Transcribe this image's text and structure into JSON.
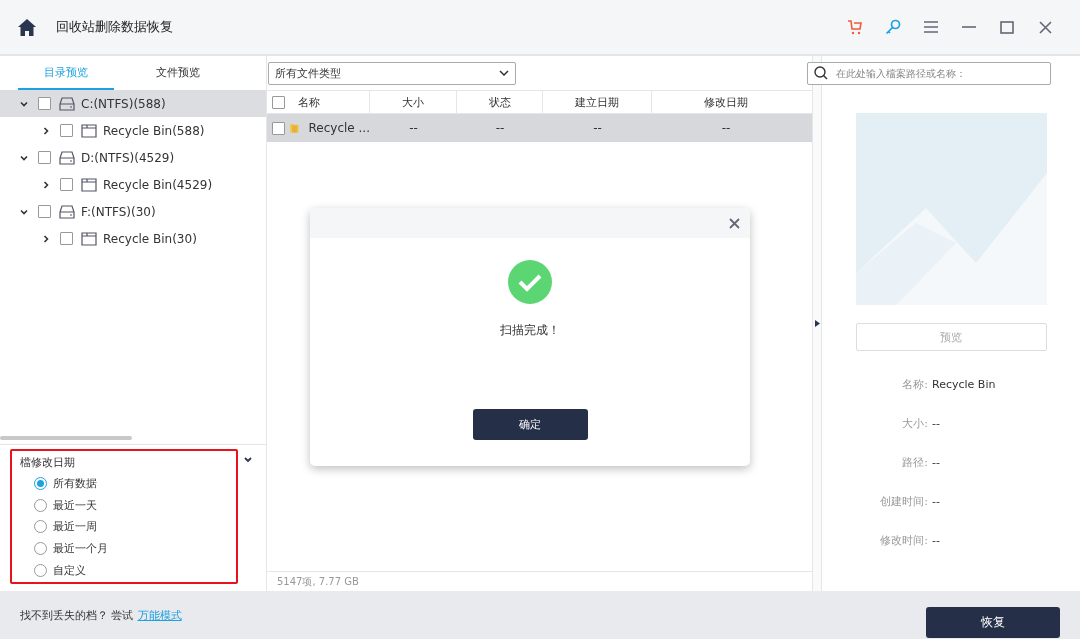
{
  "window": {
    "title": "回收站删除数据恢复"
  },
  "tabs": [
    {
      "label": "目录预览",
      "selected": true
    },
    {
      "label": "文件预览",
      "selected": false
    }
  ],
  "tree": [
    {
      "label": "C:(NTFS)(588)",
      "kind": "drive",
      "checked": false,
      "expanded": true,
      "selected": true,
      "children": [
        {
          "label": "Recycle Bin(588)",
          "kind": "folder",
          "checked": false,
          "expanded": false,
          "selected": false
        }
      ]
    },
    {
      "label": "D:(NTFS)(4529)",
      "kind": "drive",
      "checked": false,
      "expanded": true,
      "selected": false,
      "children": [
        {
          "label": "Recycle Bin(4529)",
          "kind": "folder",
          "checked": false,
          "expanded": false,
          "selected": false
        }
      ]
    },
    {
      "label": "F:(NTFS)(30)",
      "kind": "drive",
      "checked": false,
      "expanded": true,
      "selected": false,
      "children": [
        {
          "label": "Recycle Bin(30)",
          "kind": "folder",
          "checked": false,
          "expanded": false,
          "selected": false
        }
      ]
    }
  ],
  "filter": {
    "title": "檔修改日期",
    "options": [
      {
        "label": "所有数据",
        "selected": true
      },
      {
        "label": "最近一天",
        "selected": false
      },
      {
        "label": "最近一周",
        "selected": false
      },
      {
        "label": "最近一个月",
        "selected": false
      },
      {
        "label": "自定义",
        "selected": false
      }
    ]
  },
  "file_type_select": {
    "value": "所有文件类型"
  },
  "search": {
    "placeholder": "在此处输入檔案路径或名称："
  },
  "table": {
    "all_checked": false,
    "columns": [
      "名称",
      "大小",
      "状态",
      "建立日期",
      "修改日期"
    ],
    "rows": [
      {
        "cells": [
          "Recycle ...",
          "--",
          "--",
          "--",
          "--"
        ],
        "checked": false,
        "selected": true
      }
    ]
  },
  "summary": "5147项, 7.77  GB",
  "dialog": {
    "message": "扫描完成！",
    "button": "确定"
  },
  "details": {
    "preview_button": "预览",
    "fields": [
      {
        "label": "名称:",
        "value": "Recycle Bin"
      },
      {
        "label": "大小:",
        "value": "--"
      },
      {
        "label": "路径:",
        "value": "--"
      },
      {
        "label": "创建时间:",
        "value": "--"
      },
      {
        "label": "修改时间:",
        "value": "--"
      }
    ]
  },
  "footer": {
    "hint": "找不到丢失的档？ 尝试",
    "link": "万能模式",
    "button": "恢复"
  }
}
